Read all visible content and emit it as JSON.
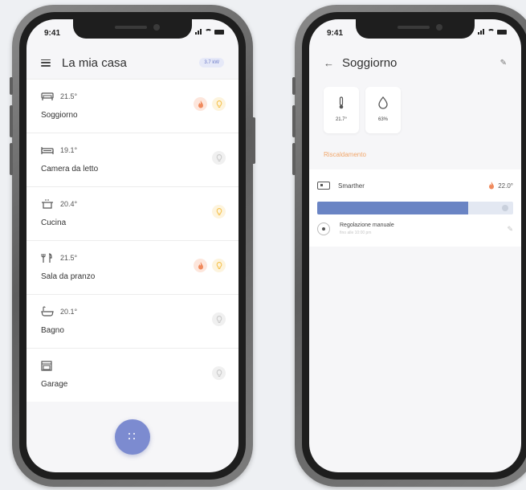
{
  "left_phone": {
    "status_time": "9:41",
    "title": "La mia casa",
    "power_badge": "3.7 kW",
    "rooms": [
      {
        "icon": "sofa-icon",
        "temp": "21.5°",
        "name": "Soggiorno",
        "actions": [
          "flame",
          "bulb"
        ]
      },
      {
        "icon": "bed-icon",
        "temp": "19.1°",
        "name": "Camera da letto",
        "actions": [
          "bulb-off"
        ]
      },
      {
        "icon": "pot-icon",
        "temp": "20.4°",
        "name": "Cucina",
        "actions": [
          "bulb"
        ]
      },
      {
        "icon": "cutlery-icon",
        "temp": "21.5°",
        "name": "Sala da pranzo",
        "actions": [
          "flame",
          "bulb"
        ]
      },
      {
        "icon": "bathtub-icon",
        "temp": "20.1°",
        "name": "Bagno",
        "actions": [
          "bulb-off"
        ]
      },
      {
        "icon": "garage-icon",
        "temp": "",
        "name": "Garage",
        "actions": [
          "bulb-off"
        ]
      }
    ]
  },
  "right_phone": {
    "status_time": "9:41",
    "title": "Soggiorno",
    "tiles": [
      {
        "icon": "thermometer-icon",
        "value": "21.7°"
      },
      {
        "icon": "humidity-drop-icon",
        "value": "63%"
      }
    ],
    "section_label": "Riscaldamento",
    "device": {
      "name": "Smarther",
      "setpoint": "22.0°",
      "level_fraction": 0.77
    },
    "mode": {
      "label": "Regolazione manuale",
      "sublabel": "fino alle 10:00 pm"
    }
  },
  "colors": {
    "accent": "#7c8bd0",
    "flame": "#f08a5d",
    "bulb": "#f5c04a",
    "section": "#f1a66a",
    "bar": "#6a84c4"
  }
}
